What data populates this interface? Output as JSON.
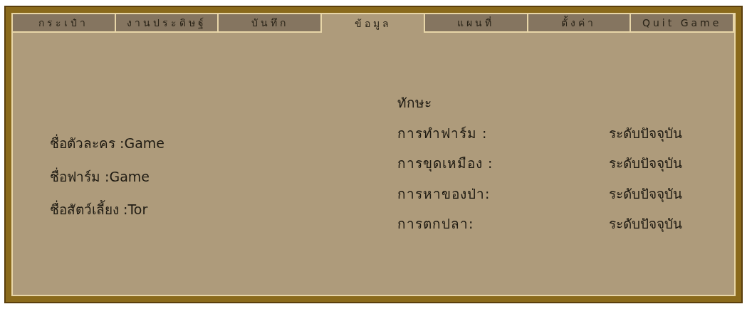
{
  "tabs": [
    {
      "label": "กระเป๋า",
      "selected": false
    },
    {
      "label": "งานประดิษฐ์",
      "selected": false
    },
    {
      "label": "บันทึก",
      "selected": false
    },
    {
      "label": "ข้อมูล",
      "selected": true
    },
    {
      "label": "แผนที่",
      "selected": false
    },
    {
      "label": "ตั้งค่า",
      "selected": false
    },
    {
      "label": "Quit Game",
      "selected": false
    }
  ],
  "profile": [
    {
      "label": "ชื่อตัวละคร :Game"
    },
    {
      "label": "ชื่อฟาร์ม :Game"
    },
    {
      "label": "ชื่อสัตว์เลี้ยง :Tor"
    }
  ],
  "skills": {
    "title": "ทักษะ",
    "items": [
      {
        "name": "การทำฟาร์ม :",
        "level_text": "ระดับปัจจุบัน"
      },
      {
        "name": "การขุดเหมือง :",
        "level_text": "ระดับปัจจุบัน"
      },
      {
        "name": "การหาของป่า:",
        "level_text": "ระดับปัจจุบัน"
      },
      {
        "name": "การตกปลา:",
        "level_text": "ระดับปัจจุบัน"
      }
    ]
  }
}
